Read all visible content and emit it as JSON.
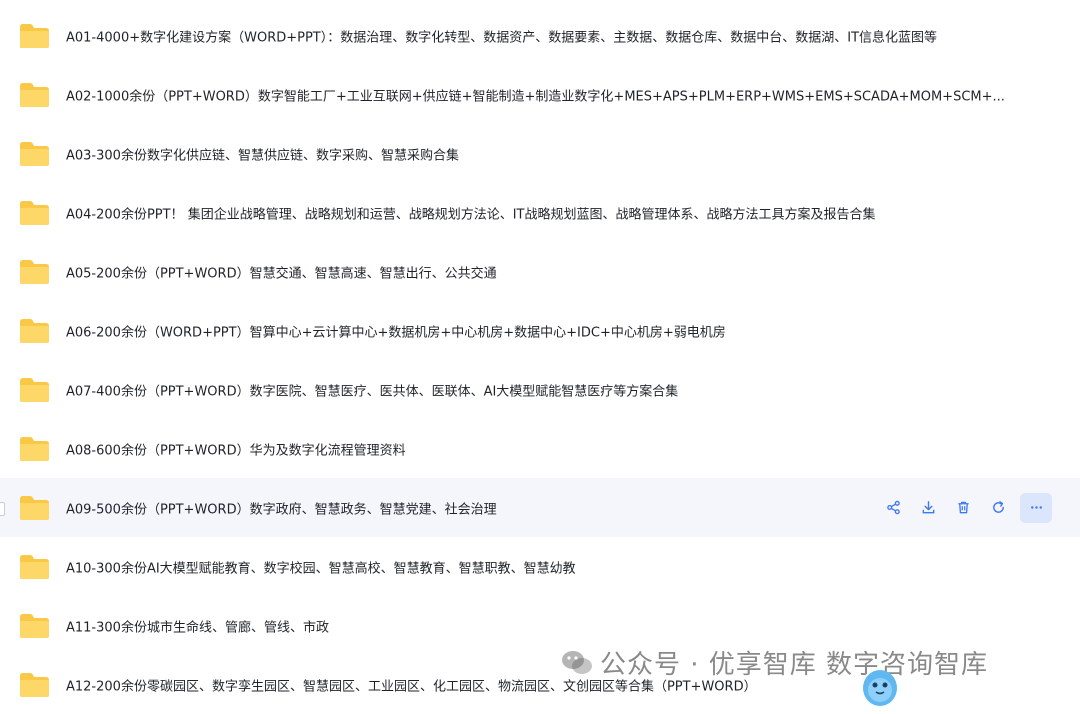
{
  "folders": [
    {
      "name": "A01-4000+数字化建设方案（WORD+PPT）：数据治理、数字化转型、数据资产、数据要素、主数据、数据仓库、数据中台、数据湖、IT信息化蓝图等"
    },
    {
      "name": "A02-1000余份（PPT+WORD）数字智能工厂+工业互联网+供应链+智能制造+制造业数字化+MES+APS+PLM+ERP+WMS+EMS+SCADA+MOM+SCM+..."
    },
    {
      "name": "A03-300余份数字化供应链、智慧供应链、数字采购、智慧采购合集"
    },
    {
      "name": "A04-200余份PPT！ 集团企业战略管理、战略规划和运营、战略规划方法论、IT战略规划蓝图、战略管理体系、战略方法工具方案及报告合集"
    },
    {
      "name": "A05-200余份（PPT+WORD）智慧交通、智慧高速、智慧出行、公共交通"
    },
    {
      "name": "A06-200余份（WORD+PPT）智算中心+云计算中心+数据机房+中心机房+数据中心+IDC+中心机房+弱电机房"
    },
    {
      "name": "A07-400余份（PPT+WORD）数字医院、智慧医疗、医共体、医联体、AI大模型赋能智慧医疗等方案合集"
    },
    {
      "name": "A08-600余份（PPT+WORD）华为及数字化流程管理资料"
    },
    {
      "name": "A09-500余份（PPT+WORD）数字政府、智慧政务、智慧党建、社会治理"
    },
    {
      "name": "A10-300余份AI大模型赋能教育、数字校园、智慧高校、智慧教育、智慧职教、智慧幼教"
    },
    {
      "name": "A11-300余份城市生命线、管廊、管线、市政"
    },
    {
      "name": "A12-200余份零碳园区、数字孪生园区、智慧园区、工业园区、化工园区、物流园区、文创园区等合集（PPT+WORD）"
    }
  ],
  "row_actions": {
    "icons": [
      "share-icon",
      "download-icon",
      "delete-icon",
      "refresh-icon",
      "more-icon"
    ]
  },
  "watermark": {
    "text": "公众号 · 优享智库 数字咨询智库"
  },
  "colors": {
    "folder": "#f9c846",
    "accent": "#3d78f5",
    "hover_row": "#f4f6fb",
    "more_bg": "#dbe6fd"
  }
}
